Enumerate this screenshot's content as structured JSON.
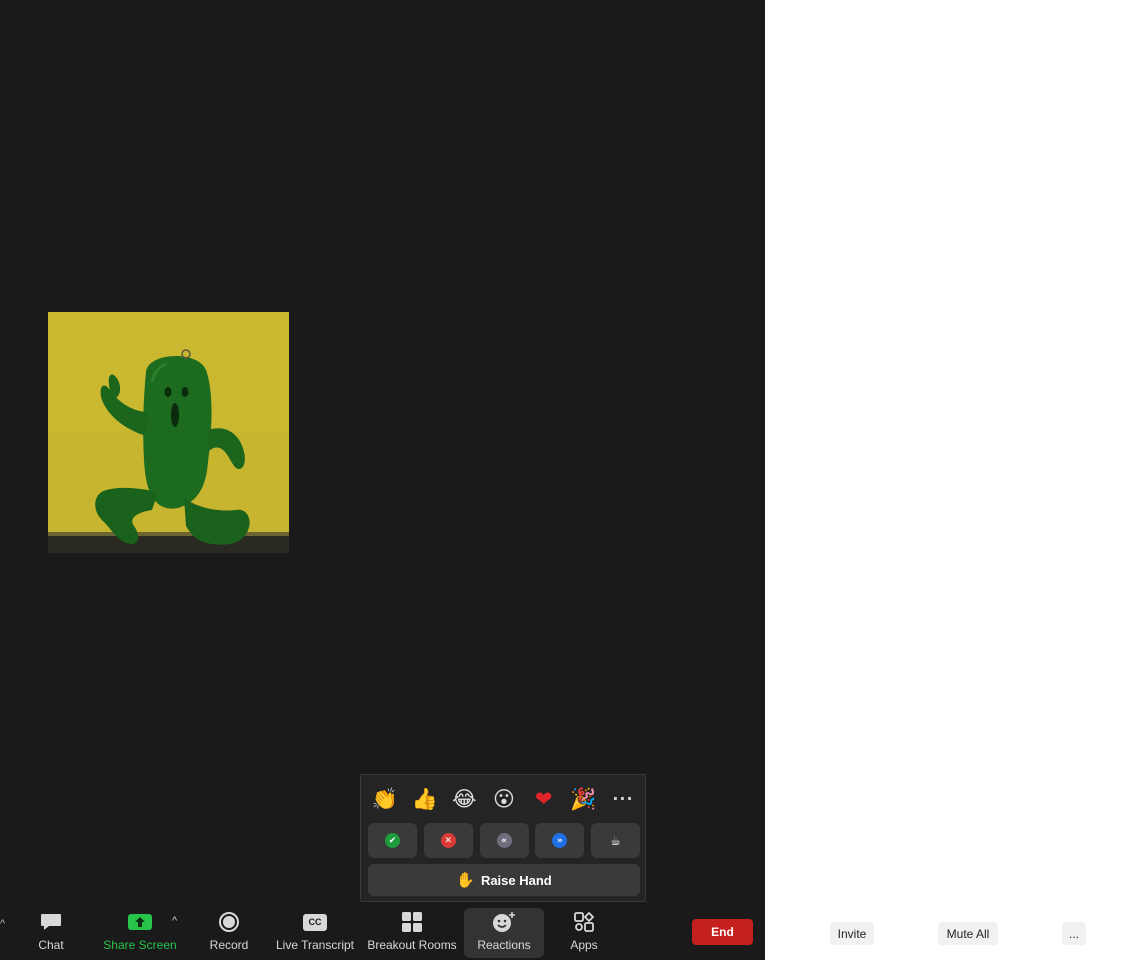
{
  "video": {
    "participant_image": "green cactus plush toy on yellow background"
  },
  "reactions": {
    "emojis": [
      {
        "icon": "clapping-hands-icon",
        "glyph": "👏"
      },
      {
        "icon": "thumbs-up-icon",
        "glyph": "👍"
      },
      {
        "icon": "tears-of-joy-icon",
        "glyph": "😂"
      },
      {
        "icon": "open-mouth-icon",
        "glyph": "😮"
      },
      {
        "icon": "heart-icon",
        "glyph": "❤"
      },
      {
        "icon": "party-popper-icon",
        "glyph": "🎉"
      }
    ],
    "more_label": "···",
    "statuses": [
      {
        "icon": "yes-check-icon",
        "glyph": "✔",
        "color": "#1e9b3a"
      },
      {
        "icon": "no-x-icon",
        "glyph": "✕",
        "color": "#d93a35"
      },
      {
        "icon": "slow-down-icon",
        "glyph": "«",
        "color": "#6e6e7e"
      },
      {
        "icon": "speed-up-icon",
        "glyph": "»",
        "color": "#1f6fe5"
      },
      {
        "icon": "coffee-break-icon",
        "glyph": "☕",
        "color": "#3a3a3a"
      }
    ],
    "raise_hand": {
      "glyph": "✋",
      "label": "Raise Hand"
    }
  },
  "toolbar": {
    "left_caret": "^",
    "chat": "Chat",
    "share_screen": "Share Screen",
    "share_caret": "^",
    "record": "Record",
    "live_transcript": "Live Transcript",
    "cc_badge": "CC",
    "breakout_rooms": "Breakout Rooms",
    "reactions": "Reactions",
    "apps": "Apps",
    "end": "End"
  },
  "participants_panel": {
    "invite": "Invite",
    "mute_all": "Mute All",
    "more": "..."
  },
  "colors": {
    "meeting_bg": "#1a1a1a",
    "share_green": "#27c44b",
    "end_red": "#c4211e"
  }
}
